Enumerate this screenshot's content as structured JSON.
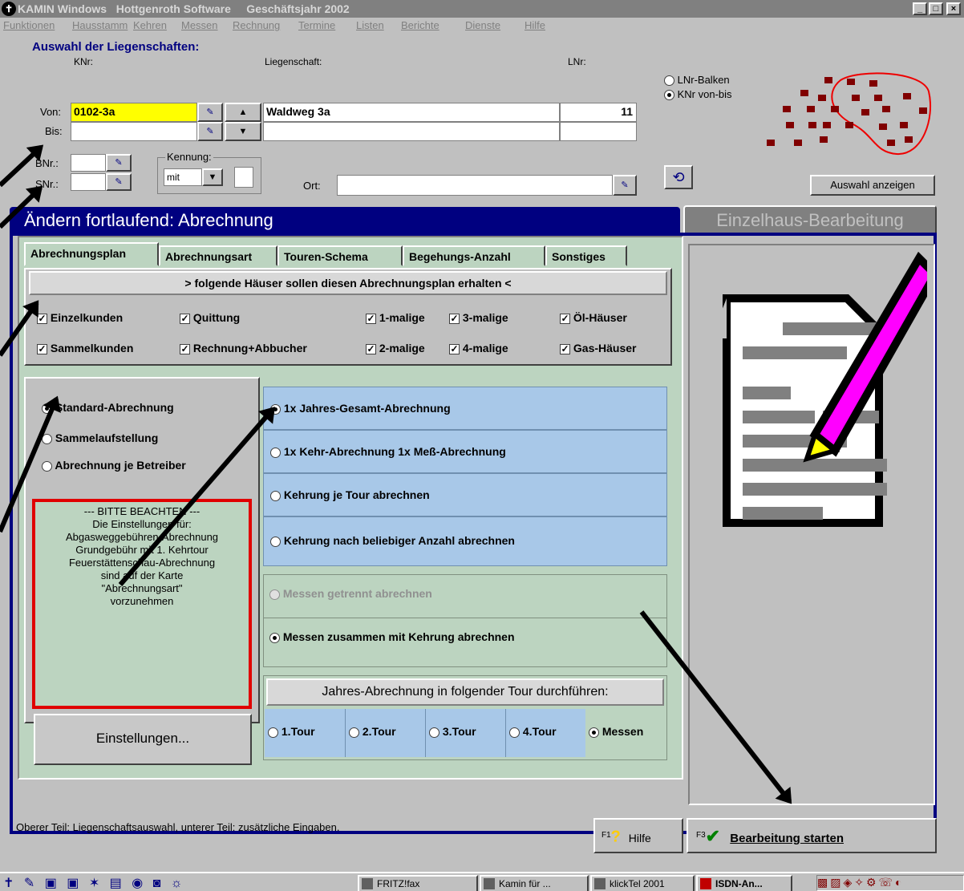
{
  "window": {
    "title": "KAMIN Windows   Hottgenroth Software     Geschäftsjahr 2002"
  },
  "menu": [
    "Funktionen",
    "Hausstamm",
    "Kehren",
    "Messen",
    "Rechnung",
    "Termine",
    "Listen",
    "Berichte",
    "Dienste",
    "Hilfe"
  ],
  "selection": {
    "heading": "Auswahl der Liegenschaften:",
    "col_knr": "KNr:",
    "col_liegenschaft": "Liegenschaft:",
    "col_lnr": "LNr:",
    "von_label": "Von:",
    "bis_label": "Bis:",
    "von_knr": "0102-3a",
    "von_liegenschaft": "Waldweg 3a",
    "von_lnr": "11",
    "bnr_label": "BNr.:",
    "snr_label": "SNr.:",
    "kennung_label": "Kennung:",
    "kennung_value": "mit",
    "ort_label": "Ort:",
    "radio_lnr": "LNr-Balken",
    "radio_knr": "KNr von-bis",
    "show_button": "Auswahl anzeigen"
  },
  "header": {
    "title": "Ändern fortlaufend: Abrechnung",
    "right_tab": "Einzelhaus-Bearbeitung"
  },
  "tabs": [
    "Abrechnungsplan",
    "Abrechnungsart",
    "Touren-Schema",
    "Begehungs-Anzahl",
    "Sonstiges"
  ],
  "plan": {
    "banner": "> folgende Häuser sollen diesen Abrechnungsplan erhalten <",
    "checks": [
      "Einzelkunden",
      "Quittung",
      "1-malige",
      "3-malige",
      "Öl-Häuser",
      "Sammelkunden",
      "Rechnung+Abbucher",
      "2-malige",
      "4-malige",
      "Gas-Häuser"
    ],
    "left_options": [
      "Standard-Abrechnung",
      "Sammelaufstellung",
      "Abrechnung je Betreiber"
    ],
    "notice_title": "---  BITTE BEACHTEN  ---",
    "notice_lines": [
      "Die Einstellungen für:",
      "Abgasweggebühren-Abrechnung",
      "Grundgebühr mit 1. Kehrtour",
      "Feuerstättenschau-Abrechnung",
      "sind auf der Karte",
      "\"Abrechnungsart\"",
      "vorzunehmen"
    ],
    "settings_button": "Einstellungen...",
    "right_options": [
      "1x Jahres-Gesamt-Abrechnung",
      "1x Kehr-Abrechnung  1x Meß-Abrechnung",
      "Kehrung je Tour abrechnen",
      "Kehrung nach beliebiger Anzahl abrechnen"
    ],
    "messen_options": [
      "Messen getrennt abrechnen",
      "Messen zusammen mit Kehrung abrechnen"
    ],
    "tour_heading": "Jahres-Abrechnung in folgender Tour durchführen:",
    "tours": [
      "1.Tour",
      "2.Tour",
      "3.Tour",
      "4.Tour",
      "Messen"
    ]
  },
  "status": {
    "text": "Oberer Teil: Liegenschaftsauswahl,  unterer Teil: zusätzliche Eingaben.",
    "help_key": "F1",
    "help_label": "Hilfe",
    "start_key": "F3",
    "start_label": "Bearbeitung starten"
  },
  "taskbar": [
    "FRITZ!fax",
    "Kamin für ...",
    "klickTel 2001",
    "ISDN-An..."
  ]
}
